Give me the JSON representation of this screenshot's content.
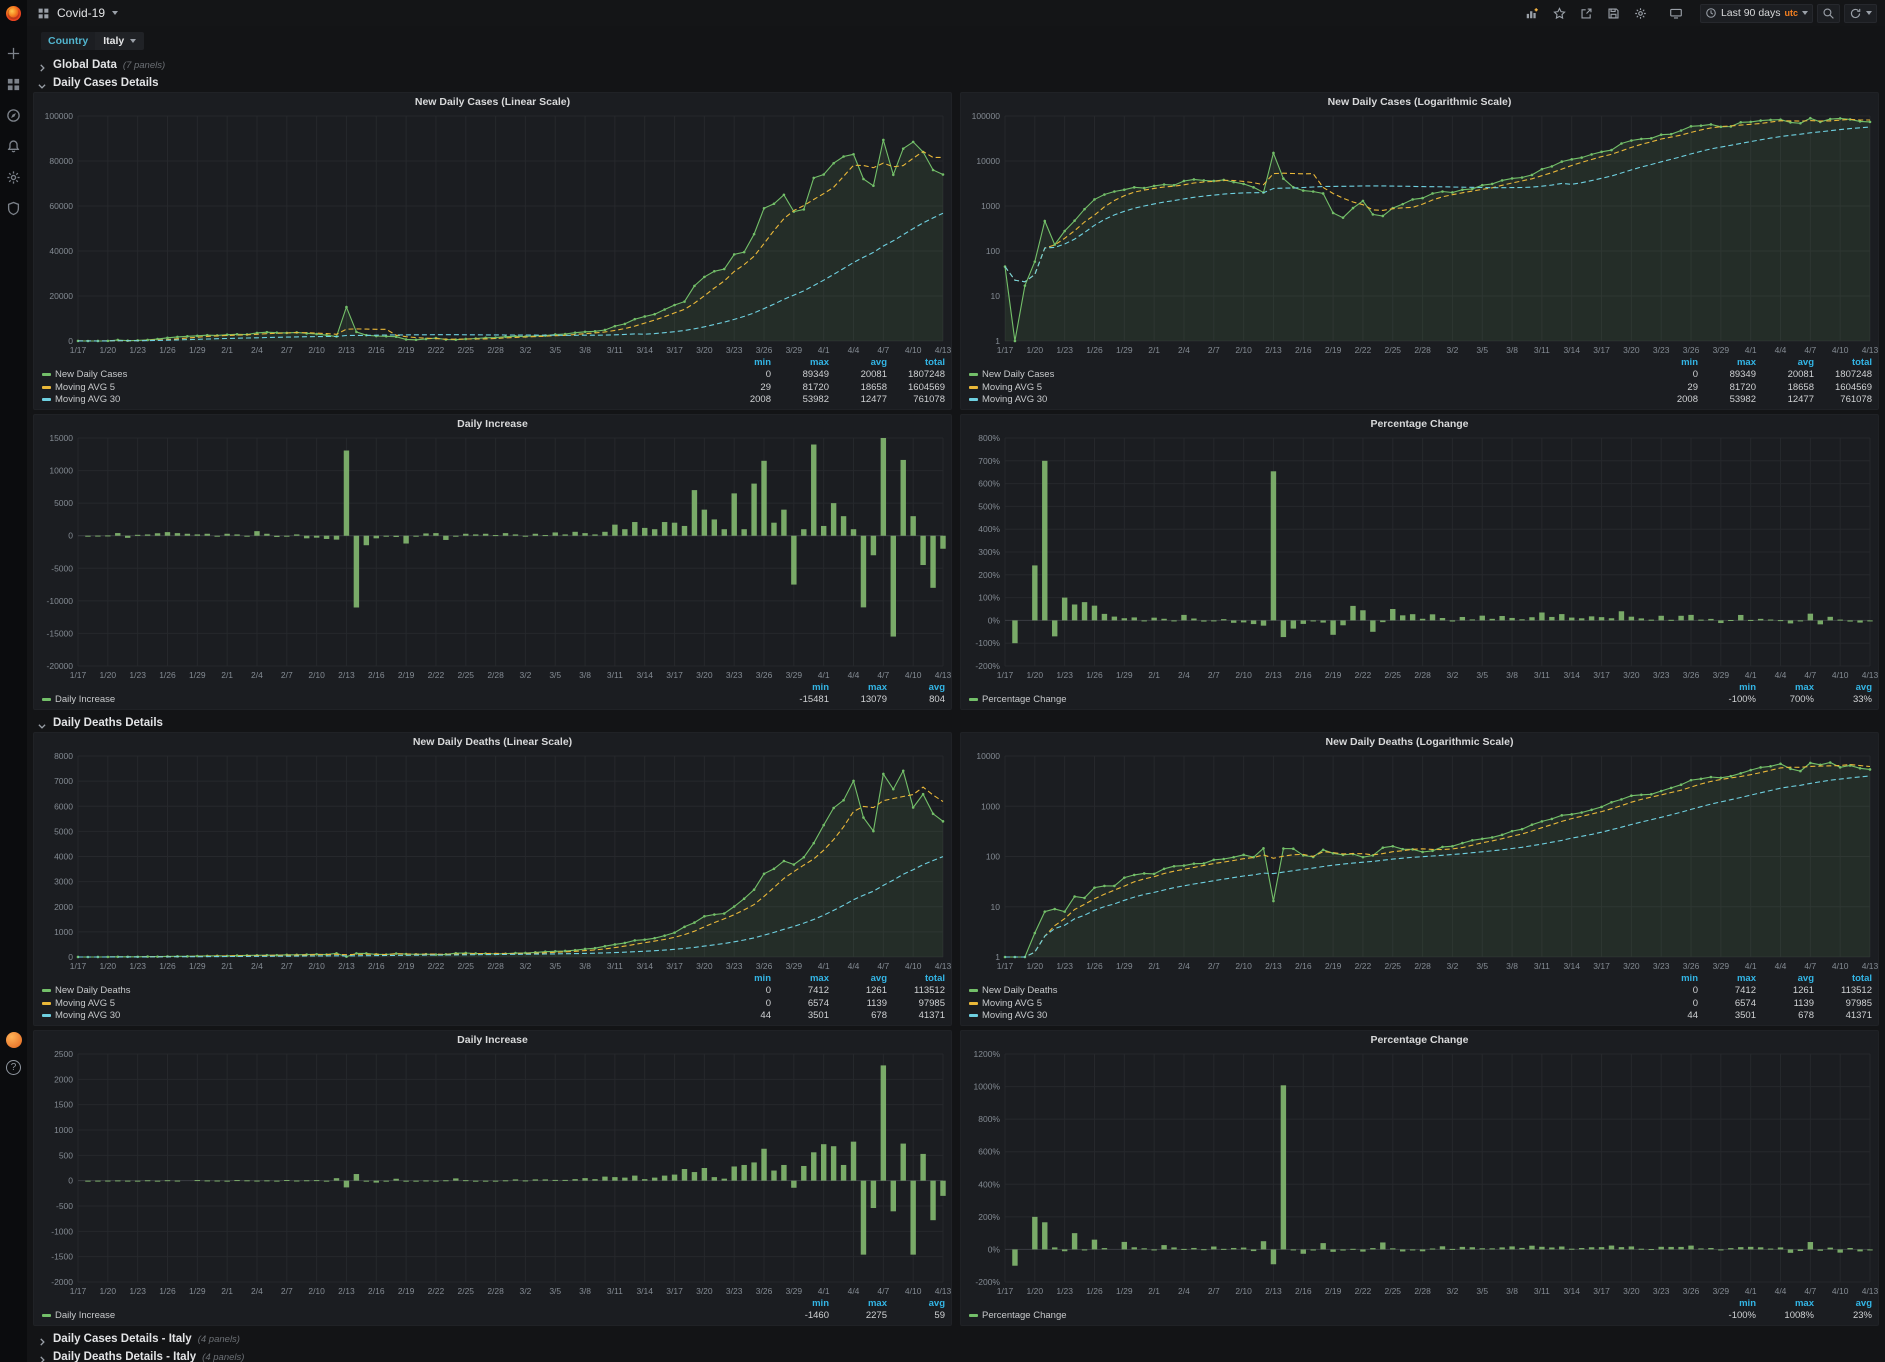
{
  "nav": {
    "title": "Covid-19",
    "toolbar": [
      "add-panel",
      "star",
      "share",
      "save",
      "settings",
      "cycle-view"
    ],
    "time_range": "Last 90 days",
    "time_zone": "utc",
    "zoom_out": "zoom-out",
    "refresh": "refresh"
  },
  "sidebar": {
    "items": [
      "create",
      "dashboards",
      "explore",
      "alerting",
      "configuration",
      "server-admin"
    ],
    "help": "?"
  },
  "submenu": {
    "label": "Country",
    "value": "Italy"
  },
  "rows": {
    "global": {
      "label": "Global Data",
      "note": "(7 panels)",
      "collapsed": true
    },
    "cases": {
      "label": "Daily Cases Details",
      "collapsed": false
    },
    "deaths": {
      "label": "Daily Deaths Details",
      "collapsed": false
    },
    "italy_cases": {
      "label": "Daily Cases Details - Italy",
      "note": "(4 panels)",
      "collapsed": true
    },
    "italy_deaths": {
      "label": "Daily Deaths Details - Italy",
      "note": "(4 panels)",
      "collapsed": true
    }
  },
  "colors": {
    "green": "#73bf69",
    "orange": "#eab839",
    "blue": "#6ed0e0",
    "stat_header": "#33b5e5",
    "grid": "#26282c",
    "axis_text": "#848b93",
    "bar": "#7eb26d"
  },
  "chart_data": {
    "type": "grafana-time-series-grid",
    "x_start": "1/17",
    "x_end": "4/13",
    "x_points": 88,
    "x_tick_every": 3,
    "x_tick_labels": [
      "1/17",
      "1/20",
      "1/23",
      "1/26",
      "1/29",
      "2/1",
      "2/4",
      "2/7",
      "2/10",
      "2/13",
      "2/16",
      "2/19",
      "2/22",
      "2/25",
      "2/28",
      "3/2",
      "3/5",
      "3/8",
      "3/11",
      "3/14",
      "3/17",
      "3/20",
      "3/23",
      "3/26",
      "3/29",
      "4/1",
      "4/4",
      "4/7",
      "4/10",
      "4/13"
    ],
    "cases": [
      45,
      0,
      17,
      58,
      464,
      139,
      278,
      472,
      850,
      1400,
      1800,
      2100,
      2300,
      2600,
      2500,
      2800,
      3000,
      2900,
      3600,
      3900,
      3700,
      3600,
      3800,
      3400,
      3100,
      2600,
      2000,
      15079,
      4061,
      2600,
      2200,
      2100,
      1900,
      700,
      550,
      900,
      1300,
      650,
      600,
      900,
      1100,
      1400,
      1500,
      1900,
      2100,
      2000,
      2300,
      2400,
      2900,
      3100,
      3700,
      4100,
      4300,
      4900,
      6600,
      7600,
      9700,
      10900,
      11900,
      14000,
      16000,
      17500,
      24500,
      28500,
      31000,
      32000,
      38500,
      39500,
      47500,
      59000,
      61000,
      65000,
      57500,
      58500,
      72500,
      74000,
      79000,
      82000,
      83000,
      72000,
      69000,
      89349,
      73868,
      85500,
      88500,
      84000,
      76000,
      74000
    ],
    "deaths": [
      1,
      0,
      1,
      3,
      8,
      9,
      8,
      16,
      15,
      24,
      26,
      26,
      38,
      43,
      46,
      45,
      57,
      64,
      66,
      72,
      73,
      86,
      89,
      97,
      108,
      97,
      146,
      13,
      144,
      143,
      105,
      98,
      136,
      116,
      108,
      112,
      97,
      105,
      150,
      160,
      140,
      139,
      123,
      130,
      155,
      160,
      185,
      210,
      225,
      240,
      270,
      320,
      350,
      430,
      500,
      560,
      660,
      690,
      750,
      850,
      970,
      1200,
      1370,
      1620,
      1690,
      1730,
      2010,
      2320,
      2680,
      3310,
      3510,
      3820,
      3680,
      3970,
      4530,
      5250,
      5930,
      6240,
      7010,
      5550,
      5010,
      7285,
      6680,
      7412,
      5952,
      6480,
      5700,
      5400
    ],
    "panels": [
      {
        "title": "New Daily Cases (Linear Scale)",
        "mode": "lines",
        "scale": "linear",
        "source": "cases",
        "ylim": [
          0,
          100000
        ],
        "yticks": [
          [
            0,
            "0"
          ],
          [
            20000,
            "20000"
          ],
          [
            40000,
            "40000"
          ],
          [
            60000,
            "60000"
          ],
          [
            80000,
            "80000"
          ],
          [
            100000,
            "100000"
          ]
        ],
        "series": [
          {
            "name": "New Daily Cases",
            "color": "#73bf69",
            "style": "solid",
            "derive": "raw"
          },
          {
            "name": "Moving AVG 5",
            "color": "#eab839",
            "style": "dashed",
            "derive": "ma5"
          },
          {
            "name": "Moving AVG 30",
            "color": "#6ed0e0",
            "style": "dashed",
            "derive": "ma30"
          }
        ],
        "legend_cols": [
          "min",
          "max",
          "avg",
          "total"
        ],
        "legend_rows": [
          {
            "name": "New Daily Cases",
            "color": "#73bf69",
            "stats": [
              "0",
              "89349",
              "20081",
              "1807248"
            ]
          },
          {
            "name": "Moving AVG 5",
            "color": "#eab839",
            "stats": [
              "29",
              "81720",
              "18658",
              "1604569"
            ]
          },
          {
            "name": "Moving AVG 30",
            "color": "#6ed0e0",
            "stats": [
              "2008",
              "53982",
              "12477",
              "761078"
            ]
          }
        ]
      },
      {
        "title": "New Daily Cases (Logarithmic Scale)",
        "mode": "lines",
        "scale": "log",
        "source": "cases",
        "ylim": [
          1,
          100000
        ],
        "yticks": [
          [
            1,
            "1"
          ],
          [
            10,
            "10"
          ],
          [
            100,
            "100"
          ],
          [
            1000,
            "1000"
          ],
          [
            10000,
            "10000"
          ],
          [
            100000,
            "100000"
          ]
        ],
        "series": [
          {
            "name": "New Daily Cases",
            "color": "#73bf69",
            "style": "solid",
            "derive": "raw"
          },
          {
            "name": "Moving AVG 5",
            "color": "#eab839",
            "style": "dashed",
            "derive": "ma5"
          },
          {
            "name": "Moving AVG 30",
            "color": "#6ed0e0",
            "style": "dashed",
            "derive": "ma30"
          }
        ],
        "legend_cols": [
          "min",
          "max",
          "avg",
          "total"
        ],
        "legend_rows": [
          {
            "name": "New Daily Cases",
            "color": "#73bf69",
            "stats": [
              "0",
              "89349",
              "20081",
              "1807248"
            ]
          },
          {
            "name": "Moving AVG 5",
            "color": "#eab839",
            "stats": [
              "29",
              "81720",
              "18658",
              "1604569"
            ]
          },
          {
            "name": "Moving AVG 30",
            "color": "#6ed0e0",
            "stats": [
              "2008",
              "53982",
              "12477",
              "761078"
            ]
          }
        ]
      },
      {
        "title": "Daily Increase",
        "mode": "bars",
        "scale": "linear",
        "source": "cases",
        "derive": "diff",
        "ylim": [
          -20000,
          15000
        ],
        "yticks": [
          [
            -20000,
            "-20000"
          ],
          [
            -15000,
            "-15000"
          ],
          [
            -10000,
            "-10000"
          ],
          [
            -5000,
            "-5000"
          ],
          [
            0,
            "0"
          ],
          [
            5000,
            "5000"
          ],
          [
            10000,
            "10000"
          ],
          [
            15000,
            "15000"
          ]
        ],
        "legend_cols": [
          "min",
          "max",
          "avg"
        ],
        "legend_rows": [
          {
            "name": "Daily Increase",
            "color": "#73bf69",
            "stats": [
              "-15481",
              "13079",
              "804"
            ]
          }
        ]
      },
      {
        "title": "Percentage Change",
        "mode": "bars",
        "scale": "linear",
        "source": "cases",
        "derive": "pct",
        "ylim": [
          -200,
          800
        ],
        "yticks": [
          [
            -200,
            "-200%"
          ],
          [
            -100,
            "-100%"
          ],
          [
            0,
            "0%"
          ],
          [
            100,
            "100%"
          ],
          [
            200,
            "200%"
          ],
          [
            300,
            "300%"
          ],
          [
            400,
            "400%"
          ],
          [
            500,
            "500%"
          ],
          [
            600,
            "600%"
          ],
          [
            700,
            "700%"
          ],
          [
            800,
            "800%"
          ]
        ],
        "legend_cols": [
          "min",
          "max",
          "avg"
        ],
        "legend_rows": [
          {
            "name": "Percentage Change",
            "color": "#73bf69",
            "stats": [
              "-100%",
              "700%",
              "33%"
            ]
          }
        ]
      },
      {
        "title": "New Daily Deaths (Linear Scale)",
        "mode": "lines",
        "scale": "linear",
        "source": "deaths",
        "ylim": [
          0,
          8000
        ],
        "yticks": [
          [
            0,
            "0"
          ],
          [
            1000,
            "1000"
          ],
          [
            2000,
            "2000"
          ],
          [
            3000,
            "3000"
          ],
          [
            4000,
            "4000"
          ],
          [
            5000,
            "5000"
          ],
          [
            6000,
            "6000"
          ],
          [
            7000,
            "7000"
          ],
          [
            8000,
            "8000"
          ]
        ],
        "series": [
          {
            "name": "New Daily Deaths",
            "color": "#73bf69",
            "style": "solid",
            "derive": "raw"
          },
          {
            "name": "Moving AVG 5",
            "color": "#eab839",
            "style": "dashed",
            "derive": "ma5"
          },
          {
            "name": "Moving AVG 30",
            "color": "#6ed0e0",
            "style": "dashed",
            "derive": "ma30"
          }
        ],
        "legend_cols": [
          "min",
          "max",
          "avg",
          "total"
        ],
        "legend_rows": [
          {
            "name": "New Daily Deaths",
            "color": "#73bf69",
            "stats": [
              "0",
              "7412",
              "1261",
              "113512"
            ]
          },
          {
            "name": "Moving AVG 5",
            "color": "#eab839",
            "stats": [
              "0",
              "6574",
              "1139",
              "97985"
            ]
          },
          {
            "name": "Moving AVG 30",
            "color": "#6ed0e0",
            "stats": [
              "44",
              "3501",
              "678",
              "41371"
            ]
          }
        ]
      },
      {
        "title": "New Daily Deaths (Logarithmic Scale)",
        "mode": "lines",
        "scale": "log",
        "source": "deaths",
        "ylim": [
          1,
          10000
        ],
        "yticks": [
          [
            1,
            "1"
          ],
          [
            10,
            "10"
          ],
          [
            100,
            "100"
          ],
          [
            1000,
            "1000"
          ],
          [
            10000,
            "10000"
          ]
        ],
        "series": [
          {
            "name": "New Daily Deaths",
            "color": "#73bf69",
            "style": "solid",
            "derive": "raw"
          },
          {
            "name": "Moving AVG 5",
            "color": "#eab839",
            "style": "dashed",
            "derive": "ma5"
          },
          {
            "name": "Moving AVG 30",
            "color": "#6ed0e0",
            "style": "dashed",
            "derive": "ma30"
          }
        ],
        "legend_cols": [
          "min",
          "max",
          "avg",
          "total"
        ],
        "legend_rows": [
          {
            "name": "New Daily Deaths",
            "color": "#73bf69",
            "stats": [
              "0",
              "7412",
              "1261",
              "113512"
            ]
          },
          {
            "name": "Moving AVG 5",
            "color": "#eab839",
            "stats": [
              "0",
              "6574",
              "1139",
              "97985"
            ]
          },
          {
            "name": "Moving AVG 30",
            "color": "#6ed0e0",
            "stats": [
              "44",
              "3501",
              "678",
              "41371"
            ]
          }
        ]
      },
      {
        "title": "Daily Increase",
        "mode": "bars",
        "scale": "linear",
        "source": "deaths",
        "derive": "diff",
        "ylim": [
          -2000,
          2500
        ],
        "yticks": [
          [
            -2000,
            "-2000"
          ],
          [
            -1500,
            "-1500"
          ],
          [
            -1000,
            "-1000"
          ],
          [
            -500,
            "-500"
          ],
          [
            0,
            "0"
          ],
          [
            500,
            "500"
          ],
          [
            1000,
            "1000"
          ],
          [
            1500,
            "1500"
          ],
          [
            2000,
            "2000"
          ],
          [
            2500,
            "2500"
          ]
        ],
        "legend_cols": [
          "min",
          "max",
          "avg"
        ],
        "legend_rows": [
          {
            "name": "Daily Increase",
            "color": "#73bf69",
            "stats": [
              "-1460",
              "2275",
              "59"
            ]
          }
        ]
      },
      {
        "title": "Percentage Change",
        "mode": "bars",
        "scale": "linear",
        "source": "deaths",
        "derive": "pct",
        "ylim": [
          -200,
          1200
        ],
        "yticks": [
          [
            -200,
            "-200%"
          ],
          [
            0,
            "0%"
          ],
          [
            200,
            "200%"
          ],
          [
            400,
            "400%"
          ],
          [
            600,
            "600%"
          ],
          [
            800,
            "800%"
          ],
          [
            1000,
            "1000%"
          ],
          [
            1200,
            "1200%"
          ]
        ],
        "legend_cols": [
          "min",
          "max",
          "avg"
        ],
        "legend_rows": [
          {
            "name": "Percentage Change",
            "color": "#73bf69",
            "stats": [
              "-100%",
              "1008%",
              "23%"
            ]
          }
        ]
      }
    ]
  }
}
